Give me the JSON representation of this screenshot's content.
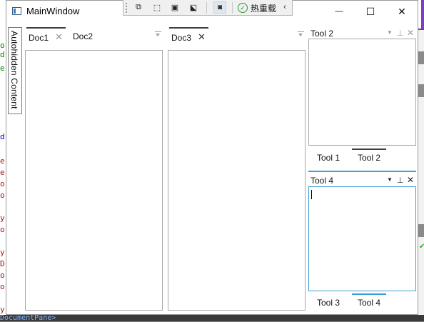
{
  "window": {
    "title": "MainWindow"
  },
  "window_controls": {
    "minimize": "—",
    "maximize": "☐",
    "close": "✕"
  },
  "debug_toolbar": {
    "hot_reload_label": "热重载",
    "collapse_glyph": "‹"
  },
  "autohide": {
    "label": "Autohidden Content"
  },
  "document_panes": [
    {
      "tabs": [
        {
          "label": "Doc1",
          "active": true,
          "closable": true
        },
        {
          "label": "Doc2",
          "active": false,
          "closable": false
        }
      ]
    },
    {
      "tabs": [
        {
          "label": "Doc3",
          "active": true,
          "closable": true
        }
      ]
    }
  ],
  "tool_panes": [
    {
      "title": "Tool 2",
      "tabs": [
        {
          "label": "Tool 1",
          "active": false
        },
        {
          "label": "Tool 2",
          "active": true
        }
      ],
      "focused": false
    },
    {
      "title": "Tool 4",
      "tabs": [
        {
          "label": "Tool 3",
          "active": false
        },
        {
          "label": "Tool 4",
          "active": true
        }
      ],
      "focused": true
    }
  ],
  "background_editor": {
    "gutter_chars": [
      {
        "ch": "o",
        "color": "#008000"
      },
      {
        "ch": "d",
        "color": "#008000"
      },
      {
        "ch": "e",
        "color": "#008000"
      },
      {
        "ch": "d",
        "color": "#0000cc"
      },
      {
        "ch": "e",
        "color": "#a31515"
      },
      {
        "ch": "e",
        "color": "#a31515"
      },
      {
        "ch": "o",
        "color": "#a31515"
      },
      {
        "ch": "o",
        "color": "#a31515"
      },
      {
        "ch": "y",
        "color": "#a31515"
      },
      {
        "ch": "o",
        "color": "#a31515"
      },
      {
        "ch": "y",
        "color": "#a31515"
      },
      {
        "ch": "D",
        "color": "#a31515"
      },
      {
        "ch": "o",
        "color": "#a31515"
      },
      {
        "ch": "o",
        "color": "#a31515"
      },
      {
        "ch": "y",
        "color": "#a31515"
      }
    ],
    "bottom_line": "DocumentPane>"
  },
  "colors": {
    "accent": "#3c9fd6",
    "tab_active": "#3f3f3f",
    "border": "#a8a8a8"
  }
}
